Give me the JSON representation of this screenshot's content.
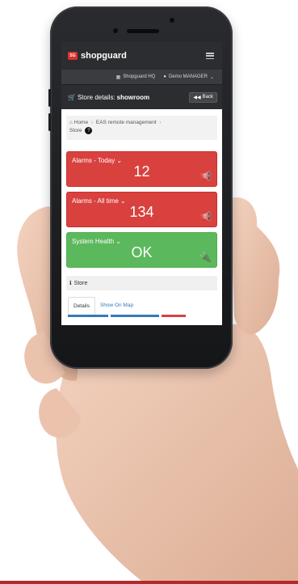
{
  "app": {
    "brand": "shopguard",
    "logo_text": "SG"
  },
  "userbar": {
    "location": "Shopguard HQ",
    "user": "Demo MANAGER"
  },
  "titlebar": {
    "prefix": "Store details:",
    "store_name": "showroom",
    "back_label": "Back"
  },
  "breadcrumb": {
    "items": [
      "Home",
      "EAS remote management",
      "Store"
    ]
  },
  "tiles": [
    {
      "label": "Alarms - Today",
      "value": "12",
      "color": "#d9413e"
    },
    {
      "label": "Alarms - All time",
      "value": "134",
      "color": "#d9413e"
    },
    {
      "label": "System Health",
      "value": "OK",
      "color": "#5cb85c"
    }
  ],
  "store": {
    "heading": "Store",
    "tabs": [
      "Details",
      "Show On Map"
    ]
  },
  "colors": {
    "alarm": "#d9413e",
    "health": "#5cb85c",
    "topbar": "#2b2d30"
  }
}
